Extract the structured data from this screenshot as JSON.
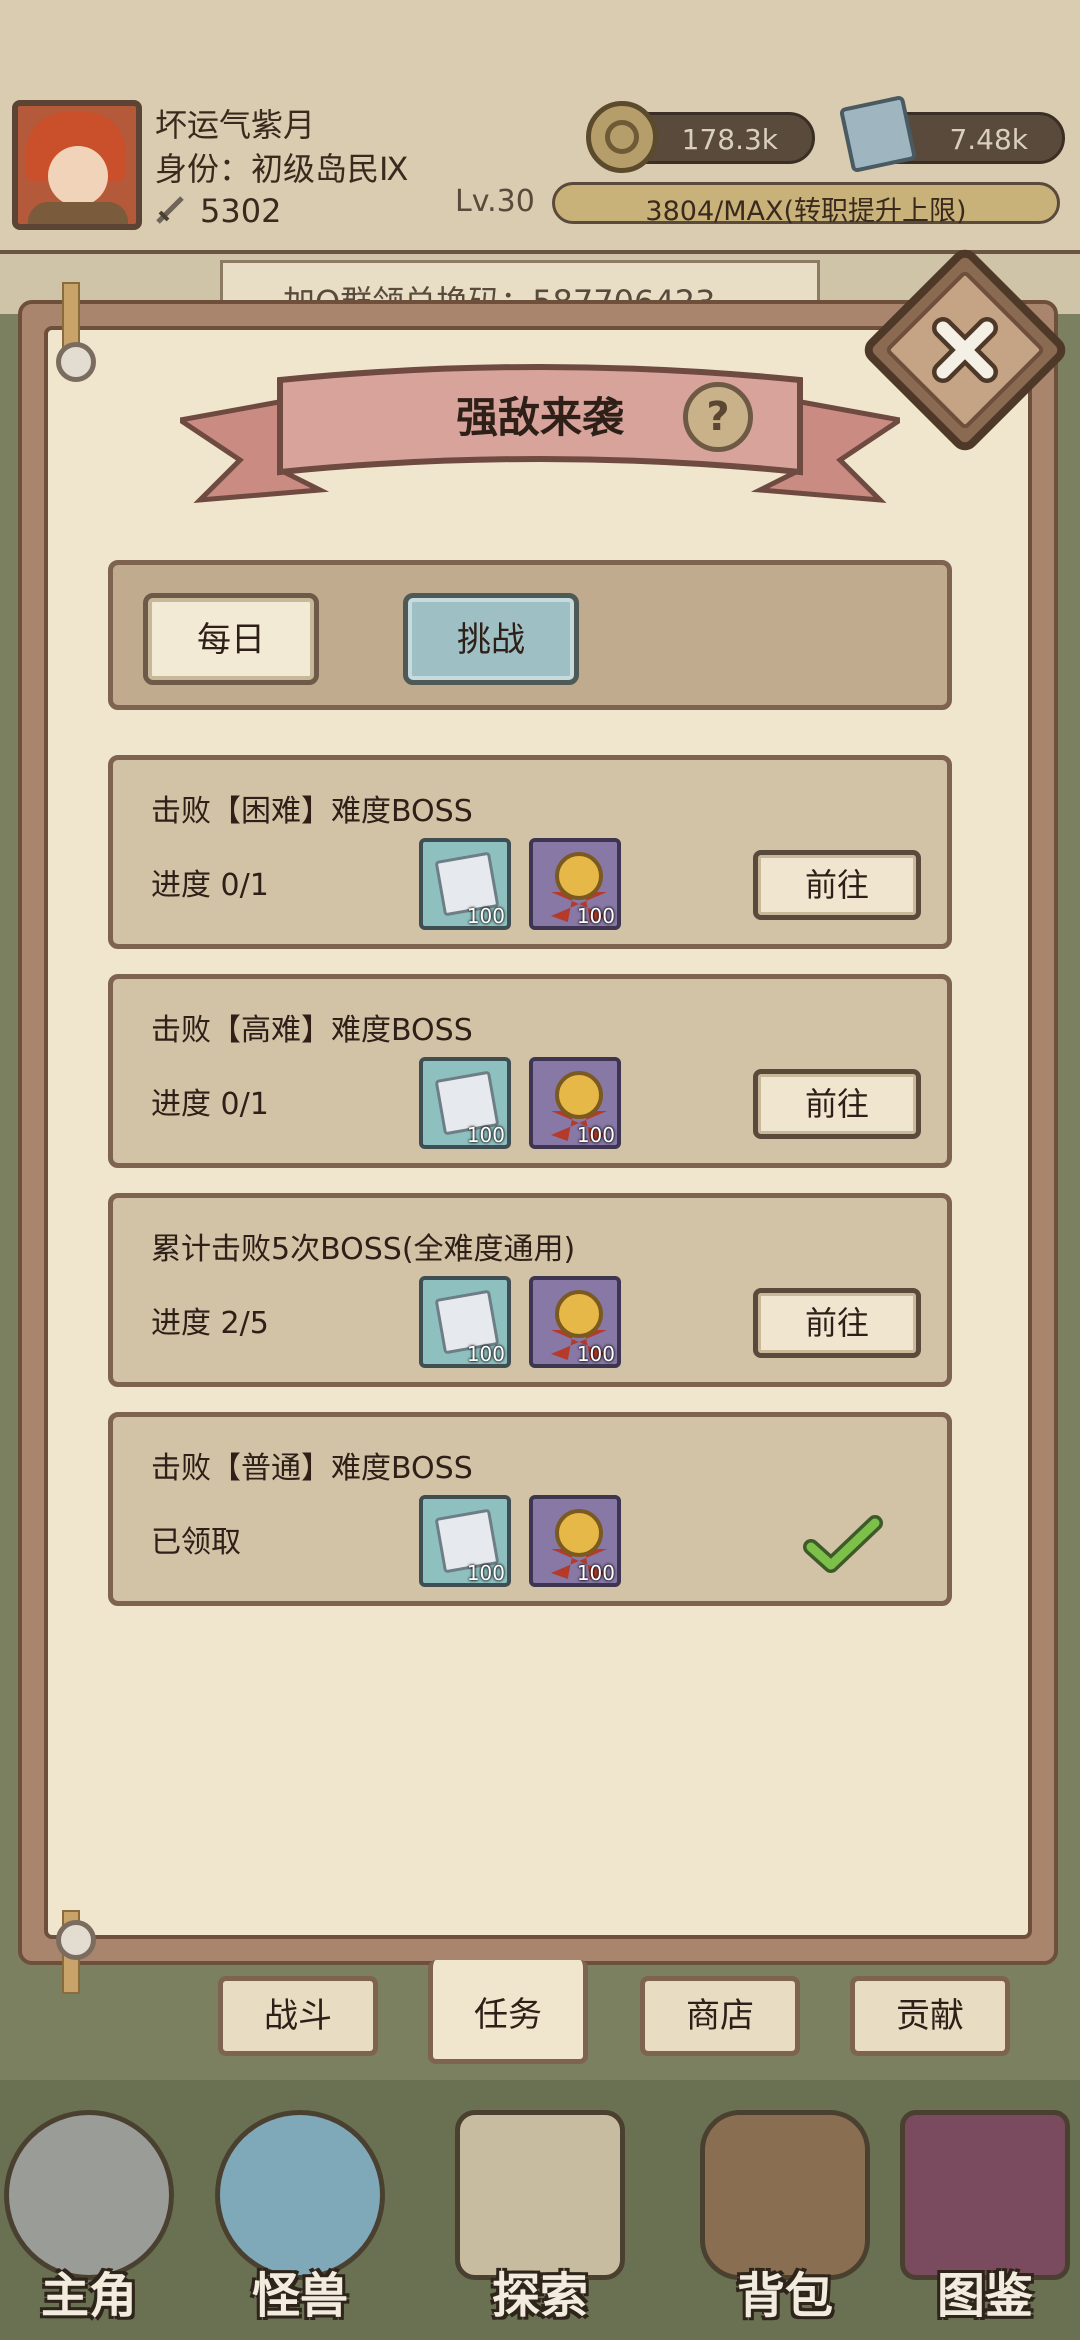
{
  "player": {
    "name": "坏运气紫月",
    "title": "身份：初级岛民Ⅸ",
    "power": "5302",
    "level": "Lv.30",
    "xp_text": "3804/MAX(转职提升上限)"
  },
  "resources": {
    "coins": "178.3k",
    "gems": "7.48k"
  },
  "background": {
    "notice": "加Q群领兑换码：587706423"
  },
  "dialog": {
    "title": "强敌来袭",
    "help_icon": "?",
    "tabs": [
      {
        "label": "每日",
        "active": false
      },
      {
        "label": "挑战",
        "active": true
      }
    ],
    "tasks": [
      {
        "title": "击败【困难】难度BOSS",
        "progress": "进度 0/1",
        "rewards": [
          {
            "icon": "gem-icon",
            "count": "100"
          },
          {
            "icon": "medal-icon",
            "count": "100"
          }
        ],
        "action": "前往",
        "claimed": false
      },
      {
        "title": "击败【高难】难度BOSS",
        "progress": "进度 0/1",
        "rewards": [
          {
            "icon": "gem-icon",
            "count": "100"
          },
          {
            "icon": "medal-icon",
            "count": "100"
          }
        ],
        "action": "前往",
        "claimed": false
      },
      {
        "title": "累计击败5次BOSS(全难度通用)",
        "progress": "进度 2/5",
        "rewards": [
          {
            "icon": "gem-icon",
            "count": "100"
          },
          {
            "icon": "medal-icon",
            "count": "100"
          }
        ],
        "action": "前往",
        "claimed": false
      },
      {
        "title": "击败【普通】难度BOSS",
        "progress": "已领取",
        "rewards": [
          {
            "icon": "gem-icon",
            "count": "100"
          },
          {
            "icon": "medal-icon",
            "count": "100"
          }
        ],
        "action": "",
        "claimed": true
      }
    ]
  },
  "subtabs": [
    {
      "label": "战斗",
      "active": false
    },
    {
      "label": "任务",
      "active": true
    },
    {
      "label": "商店",
      "active": false
    },
    {
      "label": "贡献",
      "active": false
    }
  ],
  "bottom_nav": [
    {
      "label": "主角",
      "icon": "helmet-icon"
    },
    {
      "label": "怪兽",
      "icon": "monster-eye-icon"
    },
    {
      "label": "探索",
      "icon": "map-icon"
    },
    {
      "label": "背包",
      "icon": "backpack-icon"
    },
    {
      "label": "图鉴",
      "icon": "book-icon"
    }
  ],
  "colors": {
    "panel_bg": "#efe6cd",
    "card_bg": "#d2c2a6",
    "active_tab": "#9ebfc4",
    "check_green": "#6aab3c"
  }
}
